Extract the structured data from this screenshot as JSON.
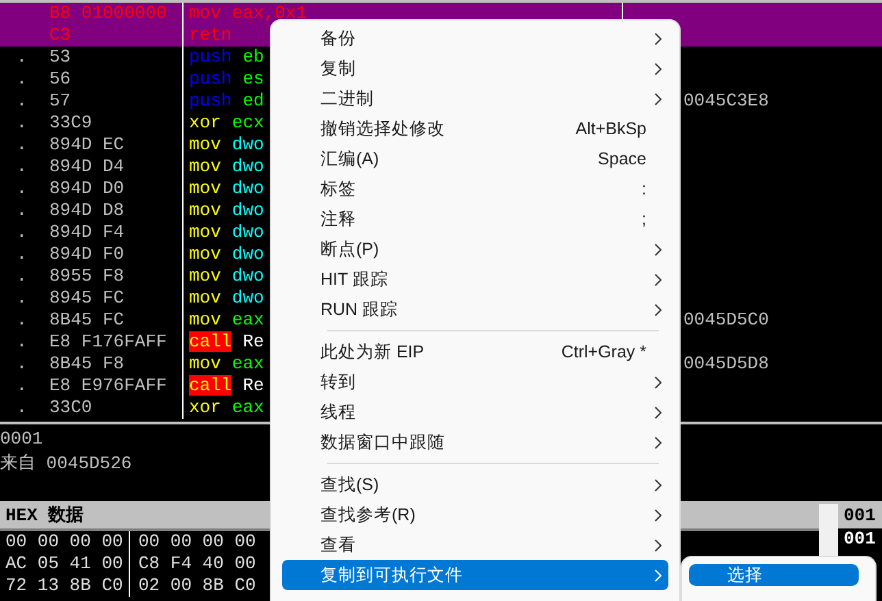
{
  "disassembly": {
    "rows": [
      {
        "hex": "B8 01000000",
        "parts": [
          {
            "kind": "mnemonic",
            "text": "mov"
          },
          {
            "kind": "register",
            "text": "eax,0x1"
          }
        ],
        "selected": true
      },
      {
        "hex": "C3",
        "parts": [
          {
            "kind": "mnemonic",
            "text": "retn"
          }
        ],
        "selected": true
      },
      {
        "marker": ".",
        "hex": "53",
        "parts": [
          {
            "kind": "stack_op",
            "text": "push"
          },
          {
            "kind": "register",
            "text": "eb"
          }
        ],
        "selected": false
      },
      {
        "marker": ".",
        "hex": "56",
        "parts": [
          {
            "kind": "stack_op",
            "text": "push"
          },
          {
            "kind": "register",
            "text": "es"
          }
        ],
        "selected": false
      },
      {
        "marker": ".",
        "hex": "57",
        "parts": [
          {
            "kind": "stack_op",
            "text": "push"
          },
          {
            "kind": "register",
            "text": "ed"
          }
        ],
        "comment": "0045C3E8",
        "selected": false
      },
      {
        "marker": ".",
        "hex": "33C9",
        "parts": [
          {
            "kind": "mnemonic",
            "text": "xor"
          },
          {
            "kind": "register",
            "text": "ecx"
          }
        ],
        "selected": false
      },
      {
        "marker": ".",
        "hex": "894D EC",
        "parts": [
          {
            "kind": "mnemonic",
            "text": "mov"
          },
          {
            "kind": "memory",
            "text": "dwo"
          }
        ],
        "selected": false
      },
      {
        "marker": ".",
        "hex": "894D D4",
        "parts": [
          {
            "kind": "mnemonic",
            "text": "mov"
          },
          {
            "kind": "memory",
            "text": "dwo"
          }
        ],
        "selected": false
      },
      {
        "marker": ".",
        "hex": "894D D0",
        "parts": [
          {
            "kind": "mnemonic",
            "text": "mov"
          },
          {
            "kind": "memory",
            "text": "dwo"
          }
        ],
        "selected": false
      },
      {
        "marker": ".",
        "hex": "894D D8",
        "parts": [
          {
            "kind": "mnemonic",
            "text": "mov"
          },
          {
            "kind": "memory",
            "text": "dwo"
          }
        ],
        "selected": false
      },
      {
        "marker": ".",
        "hex": "894D F4",
        "parts": [
          {
            "kind": "mnemonic",
            "text": "mov"
          },
          {
            "kind": "memory",
            "text": "dwo"
          }
        ],
        "selected": false
      },
      {
        "marker": ".",
        "hex": "894D F0",
        "parts": [
          {
            "kind": "mnemonic",
            "text": "mov"
          },
          {
            "kind": "memory",
            "text": "dwo"
          }
        ],
        "selected": false
      },
      {
        "marker": ".",
        "hex": "8955 F8",
        "parts": [
          {
            "kind": "mnemonic",
            "text": "mov"
          },
          {
            "kind": "memory",
            "text": "dwo"
          }
        ],
        "selected": false
      },
      {
        "marker": ".",
        "hex": "8945 FC",
        "parts": [
          {
            "kind": "mnemonic",
            "text": "mov"
          },
          {
            "kind": "memory",
            "text": "dwo"
          }
        ],
        "selected": false
      },
      {
        "marker": ".",
        "hex": "8B45 FC",
        "parts": [
          {
            "kind": "mnemonic",
            "text": "mov"
          },
          {
            "kind": "register",
            "text": "eax"
          }
        ],
        "comment": "0045D5C0",
        "selected": false
      },
      {
        "marker": ".",
        "hex": "E8 F176FAFF",
        "parts": [
          {
            "kind": "call",
            "text": "call"
          },
          {
            "kind": "symbol",
            "text": "Re"
          }
        ],
        "selected": false
      },
      {
        "marker": ".",
        "hex": "8B45 F8",
        "parts": [
          {
            "kind": "mnemonic",
            "text": "mov"
          },
          {
            "kind": "register",
            "text": "eax"
          }
        ],
        "comment": "0045D5D8",
        "selected": false
      },
      {
        "marker": ".",
        "hex": "E8 E976FAFF",
        "parts": [
          {
            "kind": "call",
            "text": "call"
          },
          {
            "kind": "symbol",
            "text": "Re"
          }
        ],
        "selected": false
      },
      {
        "marker": ".",
        "hex": "33C0",
        "parts": [
          {
            "kind": "mnemonic",
            "text": "xor"
          },
          {
            "kind": "register",
            "text": "eax"
          }
        ],
        "selected": false
      }
    ]
  },
  "info_pane": {
    "lines": [
      "0001",
      "来自  0045D526"
    ]
  },
  "hex_dump": {
    "title": "HEX 数据",
    "rows": [
      {
        "left": "00 00 00 00",
        "right": "00 00 00 00"
      },
      {
        "left": "AC 05 41 00",
        "right": "C8 F4 40 00"
      },
      {
        "left": "72 13 8B C0",
        "right": "02 00 8B C0"
      }
    ]
  },
  "stack": {
    "header": "001",
    "rows": [
      "001"
    ]
  },
  "context_menu": {
    "items": [
      {
        "kind": "item",
        "label": "备份",
        "submenu": true,
        "selected": false
      },
      {
        "kind": "item",
        "label": "复制",
        "submenu": true,
        "selected": false
      },
      {
        "kind": "item",
        "label": "二进制",
        "submenu": true,
        "selected": false
      },
      {
        "kind": "item",
        "label": "撤销选择处修改",
        "shortcut": "Alt+BkSp",
        "submenu": false,
        "selected": false
      },
      {
        "kind": "item",
        "label": "汇编(A)",
        "shortcut": "Space",
        "submenu": false,
        "selected": false
      },
      {
        "kind": "item",
        "label": "标签",
        "shortcut": ":",
        "submenu": false,
        "selected": false
      },
      {
        "kind": "item",
        "label": "注释",
        "shortcut": ";",
        "submenu": false,
        "selected": false
      },
      {
        "kind": "item",
        "label": "断点(P)",
        "submenu": true,
        "selected": false
      },
      {
        "kind": "item",
        "label": "HIT 跟踪",
        "submenu": true,
        "selected": false
      },
      {
        "kind": "item",
        "label": "RUN 跟踪",
        "submenu": true,
        "selected": false
      },
      {
        "kind": "separator"
      },
      {
        "kind": "item",
        "label": "此处为新 EIP",
        "shortcut": "Ctrl+Gray *",
        "submenu": false,
        "selected": false
      },
      {
        "kind": "item",
        "label": "转到",
        "submenu": true,
        "selected": false
      },
      {
        "kind": "item",
        "label": "线程",
        "submenu": true,
        "selected": false
      },
      {
        "kind": "item",
        "label": "数据窗口中跟随",
        "submenu": true,
        "selected": false
      },
      {
        "kind": "separator"
      },
      {
        "kind": "item",
        "label": "查找(S)",
        "submenu": true,
        "selected": false
      },
      {
        "kind": "item",
        "label": "查找参考(R)",
        "submenu": true,
        "selected": false
      },
      {
        "kind": "item",
        "label": "查看",
        "submenu": true,
        "selected": false
      },
      {
        "kind": "item",
        "label": "复制到可执行文件",
        "submenu": true,
        "selected": true
      }
    ]
  },
  "submenu": {
    "items": [
      {
        "label": "选择",
        "selected": true
      }
    ]
  }
}
